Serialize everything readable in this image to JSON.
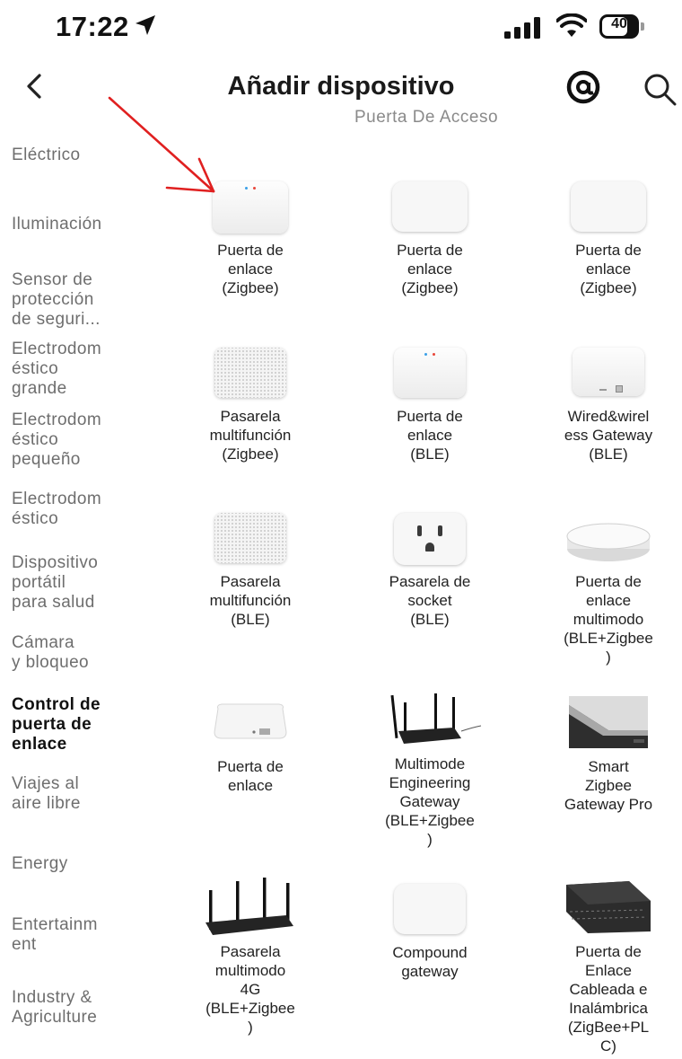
{
  "status_bar": {
    "time": "17:22",
    "battery": "40"
  },
  "header": {
    "title": "Añadir dispositivo"
  },
  "section_heading": "Puerta De Acceso",
  "sidebar": {
    "items": [
      {
        "label": "Eléctrico",
        "active": false
      },
      {
        "label": "Iluminación",
        "active": false
      },
      {
        "label": "Sensor de\nprotección\nde seguri...",
        "active": false
      },
      {
        "label": "Electrodom\néstico\ngrande",
        "active": false
      },
      {
        "label": "Electrodom\néstico\npequeño",
        "active": false
      },
      {
        "label": "Electrodom\néstico",
        "active": false
      },
      {
        "label": "Dispositivo\nportátil\npara salud",
        "active": false
      },
      {
        "label": "Cámara\ny bloqueo",
        "active": false
      },
      {
        "label": "Control de\npuerta de\nenlace",
        "active": true
      },
      {
        "label": "Viajes al\naire libre",
        "active": false
      },
      {
        "label": "Energy",
        "active": false
      },
      {
        "label": "Entertainm\nent",
        "active": false
      },
      {
        "label": "Industry &\nAgriculture",
        "active": false
      }
    ]
  },
  "devices": [
    {
      "label": "Puerta de\nenlace\n(Zigbee)",
      "icon": "gateway-cube-icon"
    },
    {
      "label": "Puerta de\nenlace\n(Zigbee)",
      "icon": "gateway-box-icon"
    },
    {
      "label": "Puerta de\nenlace\n(Zigbee)",
      "icon": "gateway-box-icon"
    },
    {
      "label": "Pasarela\nmultifunción\n(Zigbee)",
      "icon": "speaker-gateway-icon"
    },
    {
      "label": "Puerta de\nenlace\n(BLE)",
      "icon": "gateway-cube-icon"
    },
    {
      "label": "Wired&wirel\ness Gateway\n(BLE)",
      "icon": "wired-gateway-icon"
    },
    {
      "label": "Pasarela\nmultifunción\n(BLE)",
      "icon": "speaker-gateway-icon"
    },
    {
      "label": "Pasarela de\nsocket\n(BLE)",
      "icon": "socket-icon"
    },
    {
      "label": "Puerta de\nenlace\nmultimodo\n(BLE+Zigbee\n)",
      "icon": "round-gateway-icon"
    },
    {
      "label": "Puerta de\nenlace",
      "icon": "flat-gateway-icon"
    },
    {
      "label": "Multimode\nEngineering\nGateway\n(BLE+Zigbee\n)",
      "icon": "antenna-router-icon"
    },
    {
      "label": "Smart\nZigbee\nGateway Pro",
      "icon": "gateway-pro-icon"
    },
    {
      "label": "Pasarela\nmultimodo\n4G\n(BLE+Zigbee\n)",
      "icon": "router-4g-icon"
    },
    {
      "label": "Compound\ngateway",
      "icon": "gateway-box-icon"
    },
    {
      "label": "Puerta de\nEnlace\nCableada e\nInalámbrica\n(ZigBee+PL\nC)",
      "icon": "din-rail-gateway-icon"
    }
  ]
}
